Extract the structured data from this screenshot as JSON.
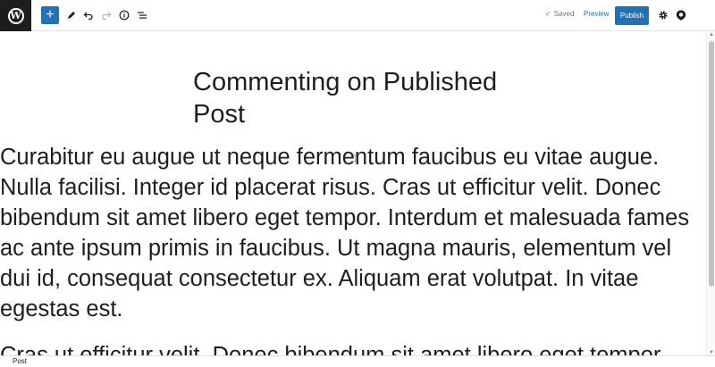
{
  "toolbar": {
    "logo_letter": "W",
    "inserter_label": "+",
    "saved_label": "Saved",
    "saved_check": "✓",
    "preview_label": "Preview",
    "publish_label": "Publish",
    "icons": [
      "wordpress-icon",
      "plus-icon",
      "pencil-icon",
      "undo-icon",
      "redo-icon",
      "info-icon",
      "list-view-icon",
      "gear-icon",
      "jetpack-icon"
    ],
    "accent_color": "#2271b1"
  },
  "post": {
    "title": "Commenting on Published Post",
    "paragraphs": [
      "Curabitur eu augue ut neque fermentum faucibus eu vitae augue. Nulla facilisi. Integer id placerat risus. Cras ut efficitur velit. Donec bibendum sit amet libero eget tempor. Interdum et malesuada fames ac ante ipsum primis in faucibus. Ut magna mauris, elementum vel dui id, consequat consectetur ex. Aliquam erat volutpat. In vitae egestas est.",
      "Cras ut efficitur velit. Donec bibendum sit amet libero eget tempor."
    ]
  },
  "footer": {
    "breadcrumb": "Post"
  }
}
